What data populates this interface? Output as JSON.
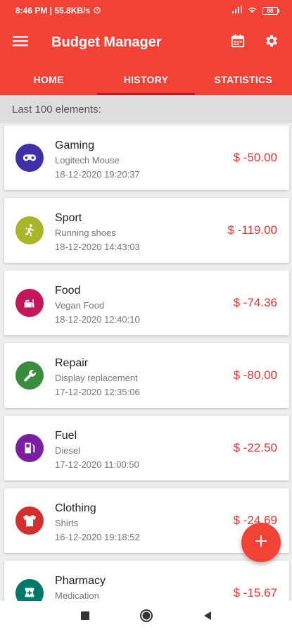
{
  "status_bar": {
    "time_speed": "8:46 PM | 55.8KB/s",
    "battery": "88"
  },
  "app_bar": {
    "title": "Budget Manager",
    "icons": [
      "menu-icon",
      "calendar-icon",
      "gear-icon"
    ]
  },
  "tabs": [
    {
      "label": "HOME",
      "active": false
    },
    {
      "label": "HISTORY",
      "active": true
    },
    {
      "label": "STATISTICS",
      "active": false
    }
  ],
  "section_header": "Last 100 elements:",
  "transactions": [
    {
      "category": "Gaming",
      "description": "Logitech Mouse",
      "date": "18-12-2020 19:20:37",
      "amount": "$ -50.00",
      "icon": "gamepad-icon",
      "color": "#3f2fa8"
    },
    {
      "category": "Sport",
      "description": "Running shoes",
      "date": "18-12-2020 14:43:03",
      "amount": "$ -119.00",
      "icon": "running-icon",
      "color": "#a8b52a"
    },
    {
      "category": "Food",
      "description": "Vegan Food",
      "date": "18-12-2020 12:40:10",
      "amount": "$ -74.36",
      "icon": "food-icon",
      "color": "#c2185b"
    },
    {
      "category": "Repair",
      "description": "Display replacement",
      "date": "17-12-2020 12:35:06",
      "amount": "$ -80.00",
      "icon": "wrench-icon",
      "color": "#388e3c"
    },
    {
      "category": "Fuel",
      "description": "Diesel",
      "date": "17-12-2020 11:00:50",
      "amount": "$ -22.50",
      "icon": "fuel-icon",
      "color": "#7b1fa2"
    },
    {
      "category": "Clothing",
      "description": "Shirts",
      "date": "16-12-2020 19:18:52",
      "amount": "$ -24.69",
      "icon": "shirt-icon",
      "color": "#d32f2f"
    },
    {
      "category": "Pharmacy",
      "description": "Medication",
      "date": "",
      "amount": "$ -15.67",
      "icon": "pharmacy-icon",
      "color": "#00796b"
    }
  ],
  "colors": {
    "primary": "#f44336",
    "amount": "#e53935"
  }
}
